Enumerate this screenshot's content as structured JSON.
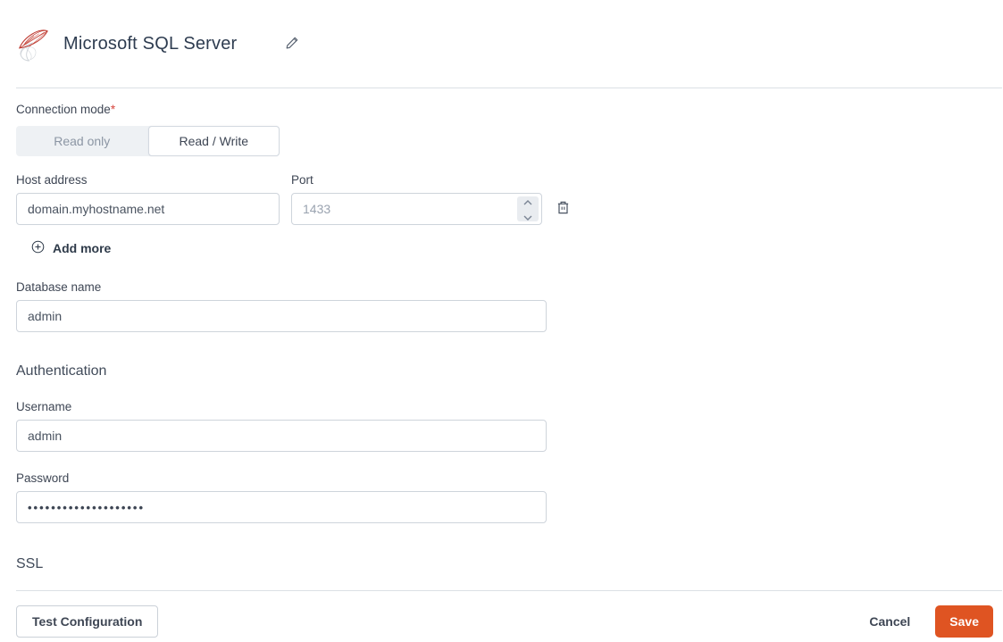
{
  "header": {
    "title": "Microsoft SQL Server"
  },
  "form": {
    "connection_mode": {
      "label": "Connection mode",
      "required_marker": "*",
      "options": [
        {
          "label": "Read only",
          "selected": false
        },
        {
          "label": "Read / Write",
          "selected": true
        }
      ]
    },
    "host": {
      "label": "Host address",
      "value": "domain.myhostname.net"
    },
    "port": {
      "label": "Port",
      "placeholder": "1433",
      "value": ""
    },
    "add_more_label": "Add more",
    "database": {
      "label": "Database name",
      "value": "admin"
    },
    "authentication": {
      "heading": "Authentication",
      "username": {
        "label": "Username",
        "value": "admin"
      },
      "password": {
        "label": "Password",
        "value": "••••••••••••••••••••"
      }
    },
    "ssl": {
      "heading": "SSL"
    }
  },
  "footer": {
    "test_label": "Test Configuration",
    "cancel_label": "Cancel",
    "save_label": "Save"
  },
  "colors": {
    "accent_orange": "#df5422",
    "required_red": "#d6453d",
    "logo_red": "#c03a31",
    "border_gray": "#ced4db",
    "text_dark": "#3e4654",
    "text_muted": "#8c96a4"
  }
}
